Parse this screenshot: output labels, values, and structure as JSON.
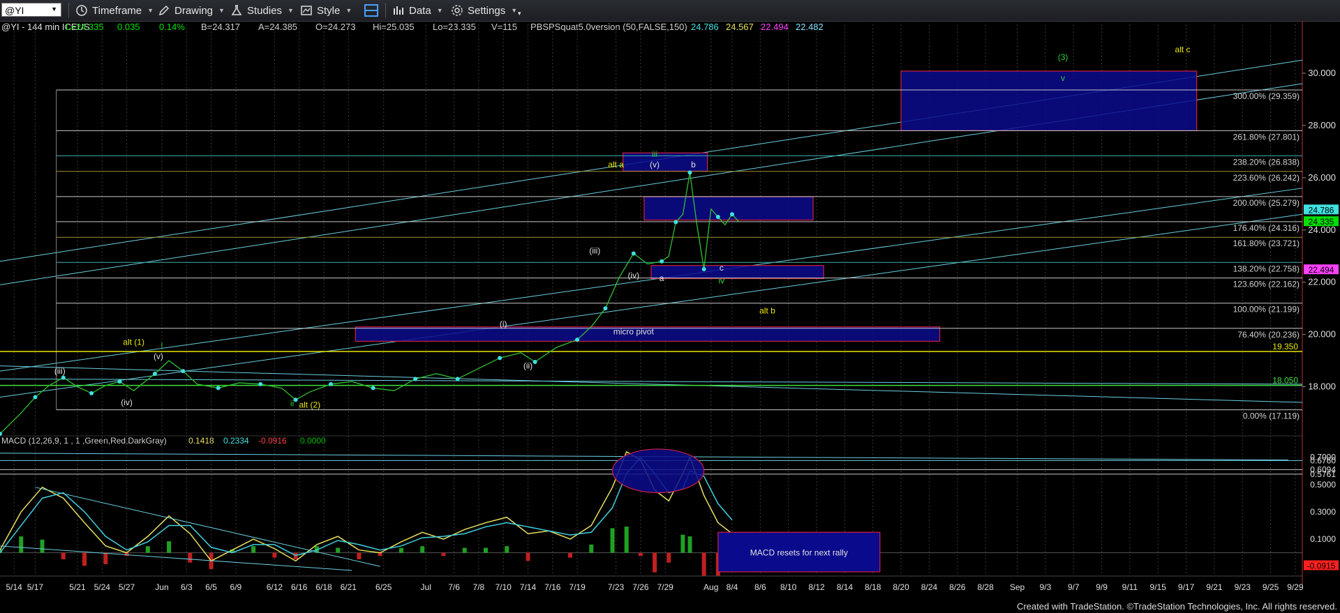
{
  "toolbar": {
    "symbol": "@YI",
    "timeframe": "Timeframe",
    "drawing": "Drawing",
    "studies": "Studies",
    "style": "Style",
    "data": "Data",
    "settings": "Settings"
  },
  "header": {
    "symbol_info": "@YI - 144 min  ICEUS",
    "stats": [
      {
        "text": "L=24.335",
        "color": "#00e000"
      },
      {
        "text": "0.035",
        "color": "#00e000"
      },
      {
        "text": "0.14%",
        "color": "#00e000"
      },
      {
        "text": "B=24.317",
        "color": "#cfcfcf"
      },
      {
        "text": "A=24.385",
        "color": "#cfcfcf"
      },
      {
        "text": "O=24.273",
        "color": "#cfcfcf"
      },
      {
        "text": "Hi=25.035",
        "color": "#cfcfcf"
      },
      {
        "text": "Lo=23.335",
        "color": "#cfcfcf"
      },
      {
        "text": "V=115",
        "color": "#cfcfcf"
      },
      {
        "text": "PBSPSquat5.0version (50,FALSE,150)",
        "color": "#cfcfcf"
      },
      {
        "text": "24.786",
        "color": "#40e0e0"
      },
      {
        "text": "24.567",
        "color": "#e8e060"
      },
      {
        "text": "22.494",
        "color": "#ff40ff"
      },
      {
        "text": "22.482",
        "color": "#80e0ff"
      }
    ]
  },
  "macd_header": [
    {
      "text": "MACD (12,26,9, 1 , 1 ,Green,Red,DarkGray)",
      "color": "#cfcfcf"
    },
    {
      "text": "0.1418",
      "color": "#e8e060"
    },
    {
      "text": "0.2334",
      "color": "#40e0e0"
    },
    {
      "text": "-0.0916",
      "color": "#ff4040"
    },
    {
      "text": "0.0000",
      "color": "#00c000"
    }
  ],
  "footer": "Created with TradeStation. ©TradeStation Technologies, Inc. All rights reserved.",
  "chart_data": {
    "type": "line",
    "price_panel": {
      "ylim": [
        16.2,
        31.2
      ],
      "y_ticks": [
        "30.000",
        "28.000",
        "26.000",
        "24.000",
        "22.000",
        "20.000",
        "18.000"
      ],
      "last_price_labels": [
        {
          "text": "24.786",
          "value": 24.786,
          "bg": "#40e0e0",
          "fg": "#000"
        },
        {
          "text": "24.335",
          "value": 24.335,
          "bg": "#00e000",
          "fg": "#000"
        },
        {
          "text": "22.494",
          "value": 22.494,
          "bg": "#ff40ff",
          "fg": "#000"
        }
      ],
      "fib_levels": [
        {
          "text": "300.00% (29.359)",
          "value": 29.359,
          "color": "#c8c8c8"
        },
        {
          "text": "261.80% (27.801)",
          "value": 27.801,
          "color": "#c8c8c8"
        },
        {
          "text": "238.20% (26.838)",
          "value": 26.838,
          "color": "#40b0b0"
        },
        {
          "text": "223.60% (26.242)",
          "value": 26.242,
          "color": "#a09030"
        },
        {
          "text": "200.00% (25.279)",
          "value": 25.279,
          "color": "#c8c8c8"
        },
        {
          "text": "176.40% (24.316)",
          "value": 24.316,
          "color": "#c8c8c8"
        },
        {
          "text": "161.80% (23.721)",
          "value": 23.721,
          "color": "#a09030"
        },
        {
          "text": "138.20% (22.758)",
          "value": 22.758,
          "color": "#40b0b0"
        },
        {
          "text": "123.60% (22.162)",
          "value": 22.162,
          "color": "#c8c8c8"
        },
        {
          "text": "100.00% (21.199)",
          "value": 21.199,
          "color": "#c8c8c8"
        },
        {
          "text": "76.40% (20.236)",
          "value": 20.236,
          "color": "#c8c8c8"
        },
        {
          "text": "0.00% (17.119)",
          "value": 17.119,
          "color": "#c8c8c8"
        }
      ],
      "horizontal_lines": [
        {
          "text": "19.350",
          "value": 19.35,
          "color": "#e8e800"
        },
        {
          "text": "18.050",
          "value": 18.05,
          "color": "#40e040"
        }
      ],
      "target_boxes": [
        {
          "y_from": 27.8,
          "y_to": 30.08
        },
        {
          "y_from": 26.25,
          "y_to": 26.95
        },
        {
          "y_from": 24.38,
          "y_to": 25.27
        },
        {
          "y_from": 22.14,
          "y_to": 22.64
        },
        {
          "y_from": 19.74,
          "y_to": 20.29
        }
      ],
      "annotations": [
        {
          "text": "(3)",
          "color": "#30d030"
        },
        {
          "text": "v",
          "color": "#30d030"
        },
        {
          "text": "alt c",
          "color": "#e8e800"
        },
        {
          "text": "alt a",
          "color": "#e8e800"
        },
        {
          "text": "iii",
          "color": "#30d030"
        },
        {
          "text": "(v)",
          "color": "#e0e0e0"
        },
        {
          "text": "b",
          "color": "#e0e0e0"
        },
        {
          "text": "(iii)",
          "color": "#e0e0e0"
        },
        {
          "text": "(iv)",
          "color": "#e0e0e0"
        },
        {
          "text": "a",
          "color": "#e0e0e0"
        },
        {
          "text": "c",
          "color": "#e0e0e0"
        },
        {
          "text": "iv",
          "color": "#30d030"
        },
        {
          "text": "alt b",
          "color": "#e8e800"
        },
        {
          "text": "micro pivot",
          "color": "#e0e0e0"
        },
        {
          "text": "(i)",
          "color": "#e0e0e0"
        },
        {
          "text": "(ii)",
          "color": "#e0e0e0"
        },
        {
          "text": "alt (1)",
          "color": "#e8e800"
        },
        {
          "text": "i",
          "color": "#30d030"
        },
        {
          "text": "(v)",
          "color": "#e0e0e0"
        },
        {
          "text": "(iii)",
          "color": "#e0e0e0"
        },
        {
          "text": "(iv)",
          "color": "#e0e0e0"
        },
        {
          "text": "ii",
          "color": "#30d030"
        },
        {
          "text": "alt (2)",
          "color": "#e8e800"
        }
      ],
      "price_series": [
        {
          "x": 0,
          "y": 16.2
        },
        {
          "x": 3,
          "y": 17.0
        },
        {
          "x": 5,
          "y": 17.6
        },
        {
          "x": 7,
          "y": 18.05
        },
        {
          "x": 9,
          "y": 18.35
        },
        {
          "x": 11,
          "y": 18.0
        },
        {
          "x": 13,
          "y": 17.75
        },
        {
          "x": 15,
          "y": 18.05
        },
        {
          "x": 17,
          "y": 18.2
        },
        {
          "x": 19,
          "y": 17.85
        },
        {
          "x": 22,
          "y": 18.5
        },
        {
          "x": 24,
          "y": 19.0
        },
        {
          "x": 26,
          "y": 18.6
        },
        {
          "x": 28,
          "y": 18.1
        },
        {
          "x": 31,
          "y": 17.95
        },
        {
          "x": 34,
          "y": 18.15
        },
        {
          "x": 37,
          "y": 18.1
        },
        {
          "x": 40,
          "y": 17.95
        },
        {
          "x": 42,
          "y": 17.5
        },
        {
          "x": 44,
          "y": 17.8
        },
        {
          "x": 47,
          "y": 18.1
        },
        {
          "x": 50,
          "y": 18.2
        },
        {
          "x": 53,
          "y": 17.95
        },
        {
          "x": 56,
          "y": 17.85
        },
        {
          "x": 59,
          "y": 18.3
        },
        {
          "x": 62,
          "y": 18.5
        },
        {
          "x": 65,
          "y": 18.3
        },
        {
          "x": 68,
          "y": 18.7
        },
        {
          "x": 71,
          "y": 19.1
        },
        {
          "x": 74,
          "y": 19.3
        },
        {
          "x": 76,
          "y": 18.95
        },
        {
          "x": 79,
          "y": 19.5
        },
        {
          "x": 82,
          "y": 19.8
        },
        {
          "x": 84,
          "y": 20.3
        },
        {
          "x": 86,
          "y": 21.0
        },
        {
          "x": 88,
          "y": 22.2
        },
        {
          "x": 90,
          "y": 23.1
        },
        {
          "x": 92,
          "y": 22.7
        },
        {
          "x": 94,
          "y": 22.8
        },
        {
          "x": 95,
          "y": 23.0
        },
        {
          "x": 96,
          "y": 24.3
        },
        {
          "x": 97,
          "y": 24.6
        },
        {
          "x": 98,
          "y": 26.2
        },
        {
          "x": 99,
          "y": 24.2
        },
        {
          "x": 100,
          "y": 22.5
        },
        {
          "x": 101,
          "y": 24.8
        },
        {
          "x": 102,
          "y": 24.5
        },
        {
          "x": 103,
          "y": 24.2
        },
        {
          "x": 104,
          "y": 24.6
        },
        {
          "x": 105,
          "y": 24.3
        }
      ]
    },
    "macd_panel": {
      "ylim": [
        -0.14,
        0.78
      ],
      "y_ticks": [
        "0.7000",
        "0.5000",
        "0.3000",
        "0.1000"
      ],
      "level_labels": [
        {
          "text": "0.6760",
          "value": 0.676
        },
        {
          "text": "0.6094",
          "value": 0.6094
        },
        {
          "text": "0.5761",
          "value": 0.5761
        }
      ],
      "last_label": {
        "text": "-0.0915",
        "value": -0.0915,
        "bg": "#ff2020"
      },
      "note": "MACD resets for next rally",
      "macd_line": [
        {
          "x": 0,
          "y": 0.02
        },
        {
          "x": 3,
          "y": 0.3
        },
        {
          "x": 6,
          "y": 0.48
        },
        {
          "x": 9,
          "y": 0.4
        },
        {
          "x": 12,
          "y": 0.22
        },
        {
          "x": 15,
          "y": 0.05
        },
        {
          "x": 18,
          "y": 0.0
        },
        {
          "x": 21,
          "y": 0.12
        },
        {
          "x": 24,
          "y": 0.27
        },
        {
          "x": 27,
          "y": 0.14
        },
        {
          "x": 30,
          "y": -0.06
        },
        {
          "x": 33,
          "y": 0.02
        },
        {
          "x": 36,
          "y": 0.1
        },
        {
          "x": 39,
          "y": 0.03
        },
        {
          "x": 42,
          "y": -0.06
        },
        {
          "x": 45,
          "y": 0.06
        },
        {
          "x": 48,
          "y": 0.12
        },
        {
          "x": 51,
          "y": 0.02
        },
        {
          "x": 54,
          "y": 0.0
        },
        {
          "x": 57,
          "y": 0.08
        },
        {
          "x": 60,
          "y": 0.15
        },
        {
          "x": 63,
          "y": 0.1
        },
        {
          "x": 66,
          "y": 0.17
        },
        {
          "x": 69,
          "y": 0.22
        },
        {
          "x": 72,
          "y": 0.26
        },
        {
          "x": 75,
          "y": 0.14
        },
        {
          "x": 78,
          "y": 0.16
        },
        {
          "x": 81,
          "y": 0.1
        },
        {
          "x": 84,
          "y": 0.2
        },
        {
          "x": 87,
          "y": 0.48
        },
        {
          "x": 89,
          "y": 0.74
        },
        {
          "x": 91,
          "y": 0.68
        },
        {
          "x": 93,
          "y": 0.46
        },
        {
          "x": 95,
          "y": 0.38
        },
        {
          "x": 97,
          "y": 0.58
        },
        {
          "x": 98,
          "y": 0.7
        },
        {
          "x": 100,
          "y": 0.42
        },
        {
          "x": 102,
          "y": 0.22
        },
        {
          "x": 104,
          "y": 0.14
        }
      ],
      "signal_line": [
        {
          "x": 0,
          "y": 0.0
        },
        {
          "x": 3,
          "y": 0.2
        },
        {
          "x": 6,
          "y": 0.4
        },
        {
          "x": 9,
          "y": 0.44
        },
        {
          "x": 12,
          "y": 0.3
        },
        {
          "x": 15,
          "y": 0.12
        },
        {
          "x": 18,
          "y": 0.02
        },
        {
          "x": 21,
          "y": 0.08
        },
        {
          "x": 24,
          "y": 0.2
        },
        {
          "x": 27,
          "y": 0.2
        },
        {
          "x": 30,
          "y": 0.04
        },
        {
          "x": 33,
          "y": 0.0
        },
        {
          "x": 36,
          "y": 0.06
        },
        {
          "x": 39,
          "y": 0.06
        },
        {
          "x": 42,
          "y": -0.02
        },
        {
          "x": 45,
          "y": 0.02
        },
        {
          "x": 48,
          "y": 0.09
        },
        {
          "x": 51,
          "y": 0.06
        },
        {
          "x": 54,
          "y": 0.02
        },
        {
          "x": 57,
          "y": 0.05
        },
        {
          "x": 60,
          "y": 0.11
        },
        {
          "x": 63,
          "y": 0.12
        },
        {
          "x": 66,
          "y": 0.14
        },
        {
          "x": 69,
          "y": 0.19
        },
        {
          "x": 72,
          "y": 0.22
        },
        {
          "x": 75,
          "y": 0.19
        },
        {
          "x": 78,
          "y": 0.16
        },
        {
          "x": 81,
          "y": 0.13
        },
        {
          "x": 84,
          "y": 0.15
        },
        {
          "x": 87,
          "y": 0.33
        },
        {
          "x": 89,
          "y": 0.58
        },
        {
          "x": 91,
          "y": 0.7
        },
        {
          "x": 93,
          "y": 0.58
        },
        {
          "x": 95,
          "y": 0.44
        },
        {
          "x": 97,
          "y": 0.47
        },
        {
          "x": 98,
          "y": 0.6
        },
        {
          "x": 100,
          "y": 0.56
        },
        {
          "x": 102,
          "y": 0.36
        },
        {
          "x": 104,
          "y": 0.24
        }
      ]
    },
    "x_axis": {
      "xlim": [
        0,
        185
      ],
      "ticks": [
        {
          "x": 2,
          "label": "5/14"
        },
        {
          "x": 5,
          "label": "5/17"
        },
        {
          "x": 11,
          "label": "5/21"
        },
        {
          "x": 14.5,
          "label": "5/24"
        },
        {
          "x": 18,
          "label": "5/27"
        },
        {
          "x": 23,
          "label": "Jun"
        },
        {
          "x": 26.5,
          "label": "6/3"
        },
        {
          "x": 30,
          "label": "6/5"
        },
        {
          "x": 33.5,
          "label": "6/9"
        },
        {
          "x": 39,
          "label": "6/12"
        },
        {
          "x": 42.5,
          "label": "6/16"
        },
        {
          "x": 46,
          "label": "6/18"
        },
        {
          "x": 49.5,
          "label": "6/21"
        },
        {
          "x": 54.5,
          "label": "6/25"
        },
        {
          "x": 60.5,
          "label": "Jul"
        },
        {
          "x": 64.5,
          "label": "7/6"
        },
        {
          "x": 68,
          "label": "7/8"
        },
        {
          "x": 71.5,
          "label": "7/10"
        },
        {
          "x": 75,
          "label": "7/14"
        },
        {
          "x": 78.5,
          "label": "7/16"
        },
        {
          "x": 82,
          "label": "7/19"
        },
        {
          "x": 87.5,
          "label": "7/23"
        },
        {
          "x": 91,
          "label": "7/26"
        },
        {
          "x": 94.5,
          "label": "7/29"
        },
        {
          "x": 101,
          "label": "Aug"
        },
        {
          "x": 104,
          "label": "8/4"
        },
        {
          "x": 108,
          "label": "8/6"
        },
        {
          "x": 112,
          "label": "8/10"
        },
        {
          "x": 116,
          "label": "8/12"
        },
        {
          "x": 120,
          "label": "8/14"
        },
        {
          "x": 124,
          "label": "8/18"
        },
        {
          "x": 128,
          "label": "8/20"
        },
        {
          "x": 132,
          "label": "8/24"
        },
        {
          "x": 136,
          "label": "8/26"
        },
        {
          "x": 140,
          "label": "8/28"
        },
        {
          "x": 144.5,
          "label": "Sep"
        },
        {
          "x": 148.5,
          "label": "9/3"
        },
        {
          "x": 152.5,
          "label": "9/7"
        },
        {
          "x": 156.5,
          "label": "9/9"
        },
        {
          "x": 160.5,
          "label": "9/11"
        },
        {
          "x": 164.5,
          "label": "9/15"
        },
        {
          "x": 168.5,
          "label": "9/17"
        },
        {
          "x": 172.5,
          "label": "9/21"
        },
        {
          "x": 176.5,
          "label": "9/23"
        },
        {
          "x": 180.5,
          "label": "9/25"
        },
        {
          "x": 184,
          "label": "9/29"
        }
      ]
    }
  }
}
